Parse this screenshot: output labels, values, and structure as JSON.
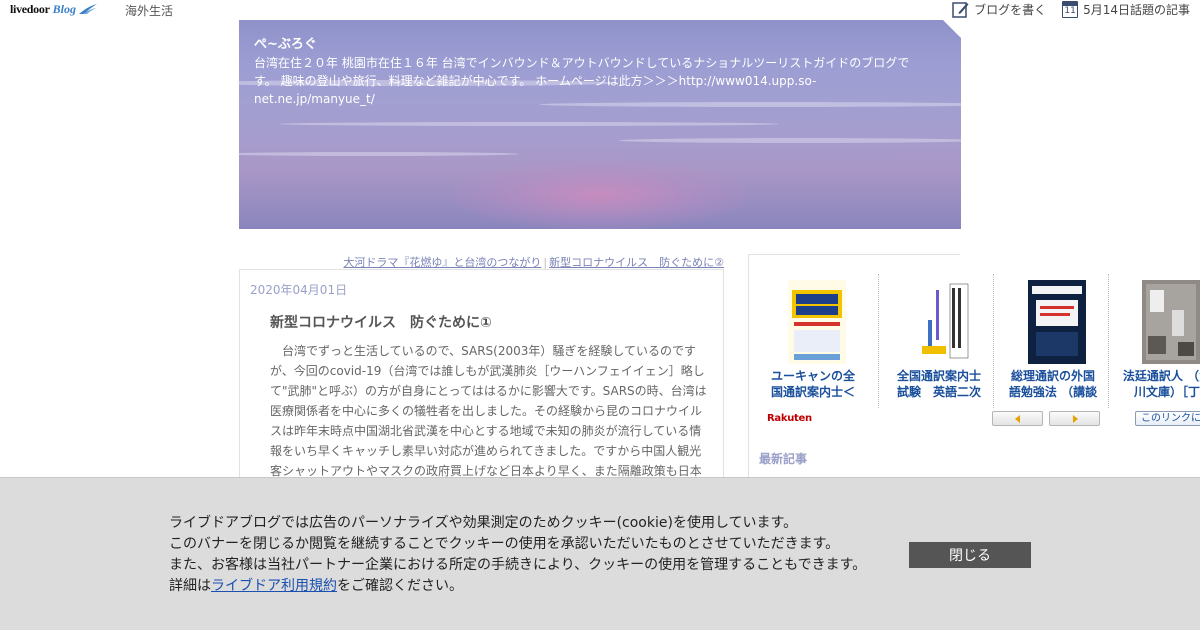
{
  "topbar": {
    "logo_text": "livedoor",
    "logo_blog": "Blog",
    "category_link": "海外生活",
    "write_blog": "ブログを書く",
    "calendar_day": "11",
    "topic_articles": "5月14日話題の記事"
  },
  "banner": {
    "title": "ぺ~ぶろぐ",
    "description": "台湾在住２０年 桃園市在住１６年 台湾でインバウンド＆アウトバウンドしているナショナルツーリストガイドのブログです。 趣味の登山や旅行、料理など雑記が中心です。 ホームページは此方＞＞＞http://www014.upp.so-net.ne.jp/manyue_t/"
  },
  "article_nav": {
    "prev": "大河ドラマ『花燃ゆ』と台湾のつながり",
    "separator": "|",
    "next": "新型コロナウイルス　防ぐために②"
  },
  "article": {
    "date": "2020年04月01日",
    "title": "新型コロナウイルス　防ぐために①",
    "body": "　台湾でずっと生活しているので、SARS(2003年）騒ぎを経験しているのですが、今回のcovid-19（台湾では誰しもが武漢肺炎［ウーハンフェイイェン］略して\"武肺\"と呼ぶ）の方が自身にとってははるかに影響大です。SARSの時、台湾は医療関係者を中心に多くの犠牲者を出しました。その経験から昆のコロナウイルスは昨年末時点中国湖北省武漢を中心とする地域で未知の肺炎が流行している情報をいち早くキャッチし素早い対応が進められてきました。ですから中国人観光客シャットアウトやマスクの政府買上げなど日本より早く、また隔離政策も日本"
  },
  "sidebar": {
    "books": [
      {
        "label_line1": "ユーキャンの全",
        "label_line2": "国通訳案内士＜"
      },
      {
        "label_line1": "全国通訳案内士",
        "label_line2": "試験　英語二次"
      },
      {
        "label_line1": "総理通訳の外国",
        "label_line2": "語勉強法 （講談"
      },
      {
        "label_line1": "法廷通訳人 （角",
        "label_line2": "川文庫）［丁"
      }
    ],
    "rakuten_label": "Rakuten",
    "link_button": "このリンクについて",
    "recent_title": "最新記事"
  },
  "cookie_banner": {
    "line1": "ライブドアブログでは広告のパーソナライズや効果測定のためクッキー(cookie)を使用しています。",
    "line2": "このバナーを閉じるか閲覧を継続することでクッキーの使用を承認いただいたものとさせていただきます。",
    "line3": "また、お客様は当社パートナー企業における所定の手続きにより、クッキーの使用を管理することもできます。",
    "line4_prefix": "詳細は",
    "line4_link": "ライブドア利用規約",
    "line4_suffix": "をご確認ください。",
    "close_button": "閉じる"
  }
}
